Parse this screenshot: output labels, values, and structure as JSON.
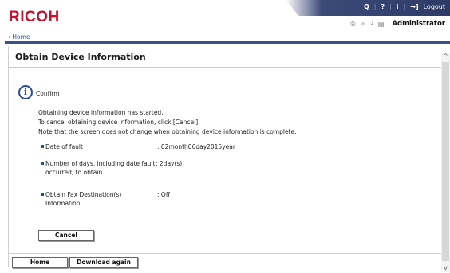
{
  "header": {
    "logo": "RICOH",
    "topbar": {
      "search_icon": "Q",
      "help_icon": "?",
      "info_icon": "i",
      "logout_icon": "→]",
      "logout_label": "Logout"
    },
    "subbar": {
      "print_icon": "⎙",
      "sparkle_icon": "✧",
      "download_icon": "⤓",
      "doc_icon": "▤",
      "user": "Administrator"
    }
  },
  "breadcrumb": "‹ Home",
  "page": {
    "title": "Obtain Device Information",
    "confirm_label": "Confirm",
    "messages": [
      "Obtaining device information has started.",
      "To cancel obtaining device information, click [Cancel].",
      "Note that the screen does not change when obtaining device information is complete."
    ],
    "details": [
      {
        "label": "Date of fault",
        "value": ": 02month06day2015year"
      },
      {
        "label": "Number of days, including date fault occurred, to obtain",
        "value": ": 2day(s)"
      },
      {
        "label": "Obtain Fax Destination(s) Information",
        "value": ": Off"
      }
    ],
    "cancel_button": "Cancel"
  },
  "footer": {
    "home_button": "Home",
    "download_again_button": "Download again"
  },
  "colors": {
    "brand": "#c8102e",
    "bar": "#3c4f88",
    "icon": "#2b4a9a"
  }
}
